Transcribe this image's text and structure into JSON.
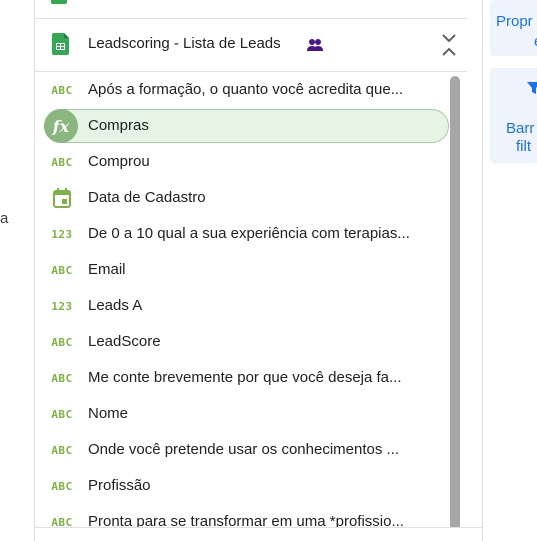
{
  "left_cut_text": "a",
  "source": {
    "name": "Leadscoring - Lista de Leads"
  },
  "fields": [
    {
      "type": "ABC",
      "label": "Após a formação, o quanto você acredita que..."
    },
    {
      "type": "fx",
      "label": "Compras",
      "selected": true
    },
    {
      "type": "ABC",
      "label": "Comprou"
    },
    {
      "type": "date",
      "label": "Data de Cadastro"
    },
    {
      "type": "123",
      "label": "De 0 a 10 qual a sua experiência com terapias..."
    },
    {
      "type": "ABC",
      "label": "Email"
    },
    {
      "type": "123",
      "label": "Leads A"
    },
    {
      "type": "ABC",
      "label": "LeadScore"
    },
    {
      "type": "ABC",
      "label": "Me conte brevemente por que você deseja fa..."
    },
    {
      "type": "ABC",
      "label": "Nome"
    },
    {
      "type": "ABC",
      "label": "Onde você pretende usar os conhecimentos ..."
    },
    {
      "type": "ABC",
      "label": "Profissão"
    },
    {
      "type": "ABC",
      "label": "Pronta para se transformar em uma *profissio..."
    }
  ],
  "right_panel": {
    "properties_line1": "Propr",
    "properties_line2": "e",
    "filter_line1": "Barr",
    "filter_line2": "filt"
  },
  "colors": {
    "type_icon": "#7cb342",
    "selected_bg": "#e6f4e5",
    "accent": "#1a73e8"
  },
  "icons": {
    "source": "google-sheets-icon",
    "shared": "people-icon",
    "collapse": "unfold-less-icon",
    "filter": "filter-icon"
  }
}
